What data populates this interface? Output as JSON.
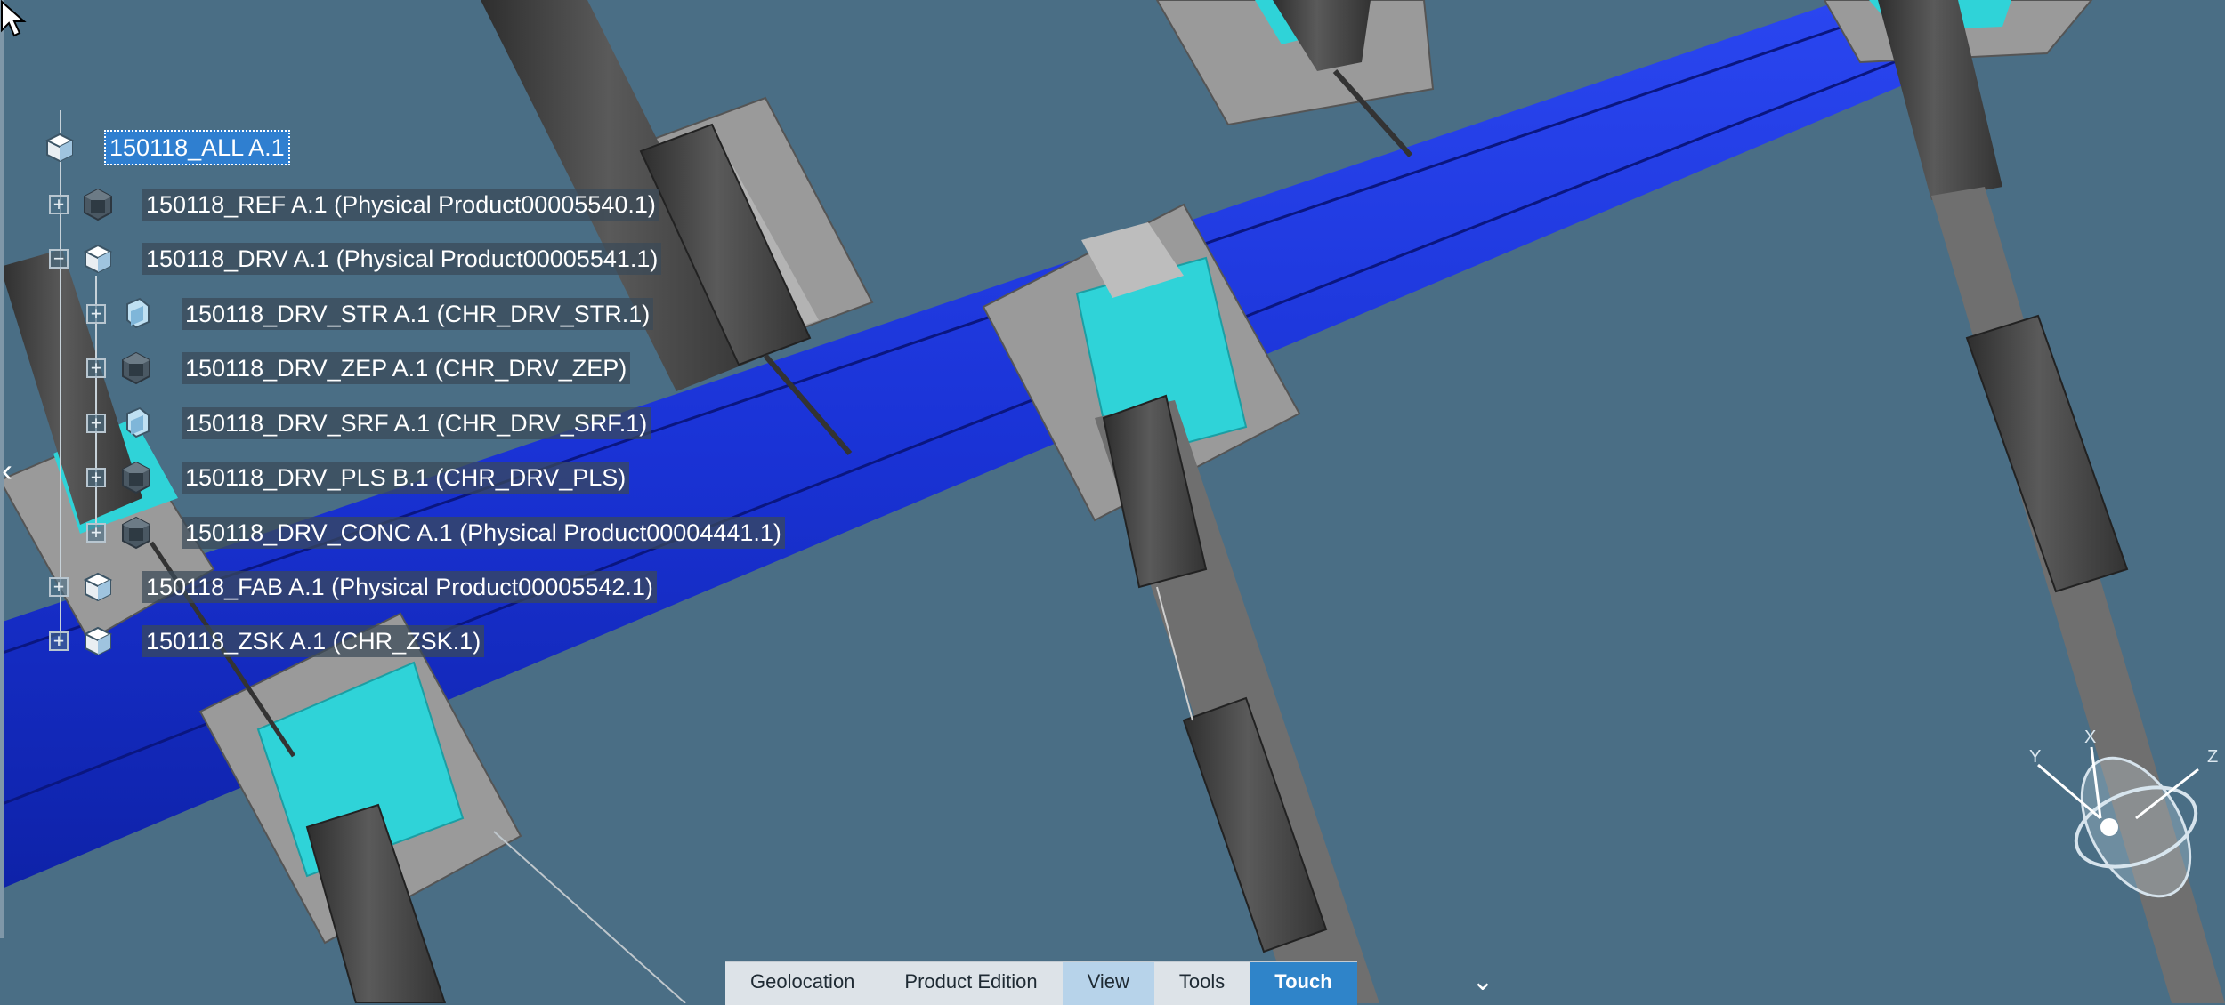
{
  "tree": {
    "root": {
      "label": "150118_ALL A.1",
      "icon": "product-icon"
    },
    "nodes": [
      {
        "label": "150118_REF A.1 (Physical Product00005540.1)",
        "icon": "part-icon",
        "expander": "+"
      },
      {
        "label": "150118_DRV A.1 (Physical Product00005541.1)",
        "icon": "product-icon",
        "expander": "−"
      },
      {
        "label": "150118_DRV_STR A.1 (CHR_DRV_STR.1)",
        "icon": "component-icon",
        "expander": "+"
      },
      {
        "label": "150118_DRV_ZEP A.1 (CHR_DRV_ZEP)",
        "icon": "part-icon",
        "expander": "+"
      },
      {
        "label": "150118_DRV_SRF A.1 (CHR_DRV_SRF.1)",
        "icon": "component-icon",
        "expander": "+"
      },
      {
        "label": "150118_DRV_PLS B.1 (CHR_DRV_PLS)",
        "icon": "part-icon",
        "expander": "+"
      },
      {
        "label": "150118_DRV_CONC A.1 (Physical Product00004441.1)",
        "icon": "part-icon",
        "expander": "+"
      },
      {
        "label": "150118_FAB A.1 (Physical Product00005542.1)",
        "icon": "product-icon",
        "expander": "+"
      },
      {
        "label": "150118_ZSK A.1 (CHR_ZSK.1)",
        "icon": "product-icon",
        "expander": "+"
      }
    ]
  },
  "toolbar": {
    "tabs": [
      {
        "label": "Geolocation"
      },
      {
        "label": "Product Edition"
      },
      {
        "label": "View"
      },
      {
        "label": "Tools"
      },
      {
        "label": "Touch"
      }
    ],
    "more_icon": "chevron-down-icon",
    "more_glyph": "⌄"
  },
  "compass": {
    "x_label": "X",
    "y_label": "Y",
    "z_label": "Z"
  },
  "panel_toggle": {
    "glyph": "‹",
    "icon": "chevron-left-icon"
  },
  "colors": {
    "background": "#4a6e85",
    "beam": "#1a33d6",
    "cyan": "#2fd3d8",
    "plate": "#8c8c8c",
    "cylinder": "#4a4a4a",
    "selection": "#2f7fd0",
    "touch_tab": "#2f84c9"
  }
}
